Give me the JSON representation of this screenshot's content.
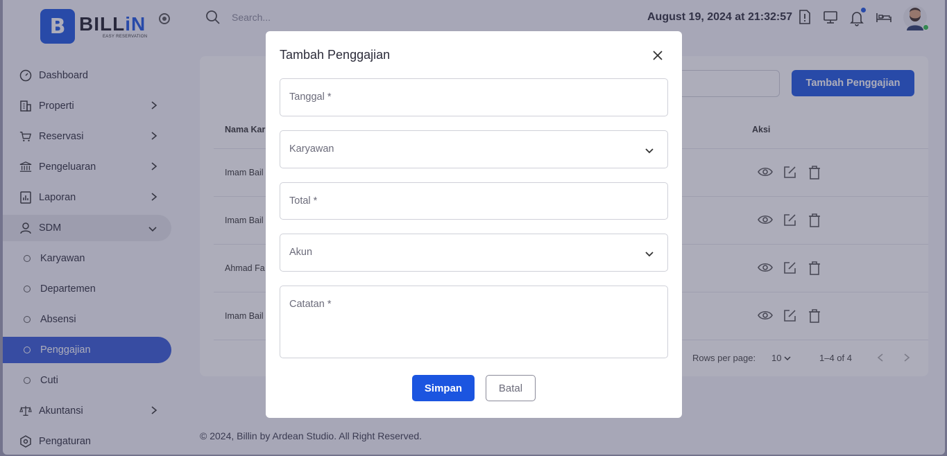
{
  "brand": {
    "name_dark": "BILL",
    "name_blue": "iN",
    "tagline": "EASY RESERVATION",
    "mark": "B"
  },
  "sidebar": {
    "items": [
      {
        "label": "Dashboard",
        "icon": "gauge-icon"
      },
      {
        "label": "Properti",
        "icon": "building-icon"
      },
      {
        "label": "Reservasi",
        "icon": "cart-icon"
      },
      {
        "label": "Pengeluaran",
        "icon": "bank-icon"
      },
      {
        "label": "Laporan",
        "icon": "report-icon"
      },
      {
        "label": "SDM",
        "icon": "user-icon"
      },
      {
        "label": "Karyawan"
      },
      {
        "label": "Departemen"
      },
      {
        "label": "Absensi"
      },
      {
        "label": "Penggajian"
      },
      {
        "label": "Cuti"
      },
      {
        "label": "Akuntansi",
        "icon": "scale-icon"
      },
      {
        "label": "Pengaturan",
        "icon": "settings-icon"
      }
    ]
  },
  "header": {
    "search_placeholder": "Search...",
    "datetime": "August 19, 2024 at 21:32:57"
  },
  "page": {
    "add_button": "Tambah Penggajian",
    "columns": {
      "name": "Nama Kar",
      "actions": "Aksi"
    },
    "rows": [
      {
        "name": "Imam Bail"
      },
      {
        "name": "Imam Bail"
      },
      {
        "name": "Ahmad Fa"
      },
      {
        "name": "Imam Bail"
      }
    ],
    "pagination": {
      "rows_label": "Rows per page:",
      "rows_value": "10",
      "range": "1–4 of 4"
    }
  },
  "footer": "© 2024, Billin by Ardean Studio. All Right Reserved.",
  "modal": {
    "title": "Tambah Penggajian",
    "fields": {
      "tanggal": "Tanggal *",
      "karyawan": "Karyawan",
      "total": "Total *",
      "akun": "Akun",
      "catatan": "Catatan *"
    },
    "save": "Simpan",
    "cancel": "Batal"
  },
  "colors": {
    "accent": "#1b55e0",
    "active_nav": "#3458d6",
    "online": "#2fbf4a"
  }
}
